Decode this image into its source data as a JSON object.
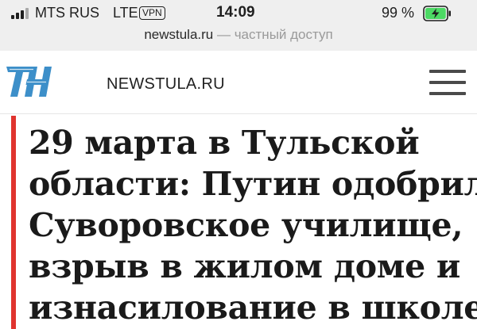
{
  "status_bar": {
    "carrier": "MTS RUS",
    "network": "LTE",
    "vpn_label": "VPN",
    "time": "14:09",
    "battery_percent": "99 %",
    "battery_level": 0.99,
    "signal_icon": "cellular-signal-icon",
    "battery_icon": "battery-charging-icon"
  },
  "address_bar": {
    "domain": "newstula.ru",
    "separator": " — ",
    "privacy_label": "частный доступ"
  },
  "site_header": {
    "logo_icon": "newstula-logo-icon",
    "site_name": "NEWSTULA.RU",
    "menu_icon": "hamburger-menu-icon"
  },
  "article": {
    "headline_lines": [
      "29 марта в Тульской",
      "области: Путин одобрил",
      "Суворовское училище,",
      "взрыв в жилом доме и",
      "изнасилование в школе"
    ],
    "accent_color": "#e0342f"
  },
  "colors": {
    "status_background": "#efefef",
    "battery_fill": "#4cd964",
    "logo_blue": "#3d8fc9"
  }
}
